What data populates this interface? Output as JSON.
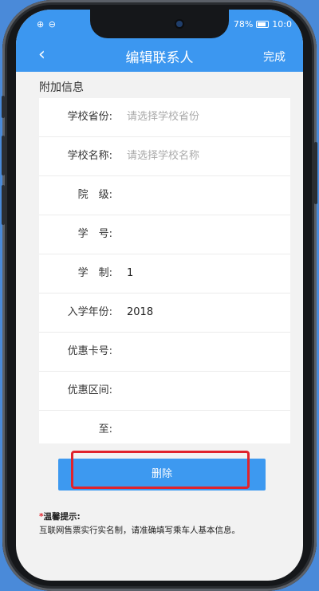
{
  "status": {
    "left_icons": "⊕ ⊖",
    "battery": "78%",
    "time": "10:0"
  },
  "navbar": {
    "back_glyph": "‹",
    "title": "编辑联系人",
    "done": "完成"
  },
  "section": {
    "title": "附加信息"
  },
  "fields": [
    {
      "label": "学校省份:",
      "value": "请选择学校省份",
      "placeholder": true
    },
    {
      "label": "学校名称:",
      "value": "请选择学校名称",
      "placeholder": true
    },
    {
      "label": "院　级:",
      "value": "",
      "placeholder": false
    },
    {
      "label": "学　号:",
      "value": "",
      "placeholder": false
    },
    {
      "label": "学　制:",
      "value": "1",
      "placeholder": false
    },
    {
      "label": "入学年份:",
      "value": "2018",
      "placeholder": false
    },
    {
      "label": "优惠卡号:",
      "value": "",
      "placeholder": false
    },
    {
      "label": "优惠区间:",
      "value": "",
      "placeholder": false
    },
    {
      "label": "至:",
      "value": "",
      "placeholder": false
    }
  ],
  "delete_button": {
    "label": "删除"
  },
  "tips": {
    "star": "*",
    "title": "温馨提示:",
    "body": "互联网售票实行实名制，请准确填写乘车人基本信息。"
  },
  "colors": {
    "accent": "#3c97f0",
    "highlight": "#e0232c"
  }
}
